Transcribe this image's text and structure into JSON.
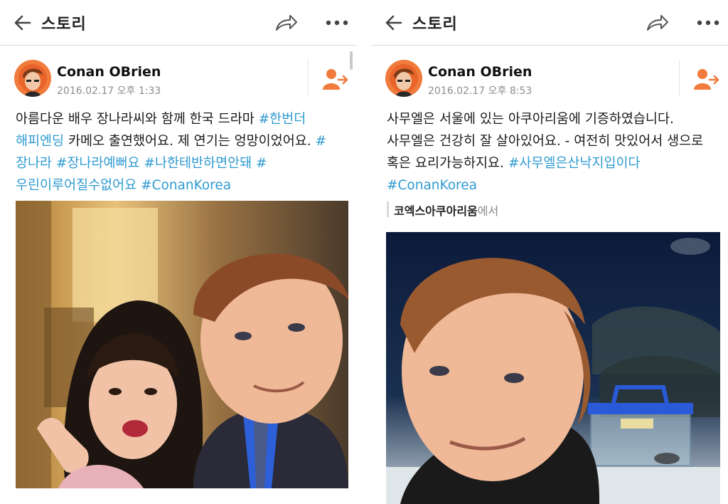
{
  "left": {
    "appbar": {
      "title": "스토리"
    },
    "post": {
      "author": "Conan OBrien",
      "timestamp": "2016.02.17 오후 1:33",
      "text_parts": [
        {
          "t": "아름다운 배우 장나라씨와 함께 한국 드라마 ",
          "tag": false
        },
        {
          "t": "#한번더 해피엔딩",
          "tag": true
        },
        {
          "t": " 카메오 출연했어요. 제 연기는 엉망이었어요. ",
          "tag": false
        },
        {
          "t": "#장나라",
          "tag": true
        },
        {
          "t": " ",
          "tag": false
        },
        {
          "t": "#장나라예뻐요",
          "tag": true
        },
        {
          "t": " ",
          "tag": false
        },
        {
          "t": "#나한테반하면안돼",
          "tag": true
        },
        {
          "t": " ",
          "tag": false
        },
        {
          "t": "#우린이루어질수없어요",
          "tag": true
        },
        {
          "t": " ",
          "tag": false
        },
        {
          "t": "#ConanKorea",
          "tag": true
        }
      ]
    }
  },
  "right": {
    "appbar": {
      "title": "스토리"
    },
    "post": {
      "author": "Conan OBrien",
      "timestamp": "2016.02.17 오후 8:53",
      "text_parts": [
        {
          "t": "사무엘은 서울에 있는 아쿠아리움에 기증하였습니다. 사무엘은 건강히 잘 살아있어요. - 여전히 맛있어서 생으로 혹은 요리가능하지요.  ",
          "tag": false
        },
        {
          "t": "#사무엘은산낙지입이다",
          "tag": true
        },
        {
          "t": " ",
          "tag": false
        },
        {
          "t": "#ConanKorea",
          "tag": true
        }
      ],
      "location": {
        "name": "코엑스아쿠아리움",
        "suffix": "에서"
      }
    }
  },
  "colors": {
    "accent_orange": "#f07b3c",
    "hashtag_blue": "#2f9bd1",
    "icon_gray": "#555555"
  },
  "icons": {
    "back": "arrow-left-icon",
    "share": "share-arrow-icon",
    "more": "more-dots-icon",
    "follow": "add-friend-icon"
  }
}
